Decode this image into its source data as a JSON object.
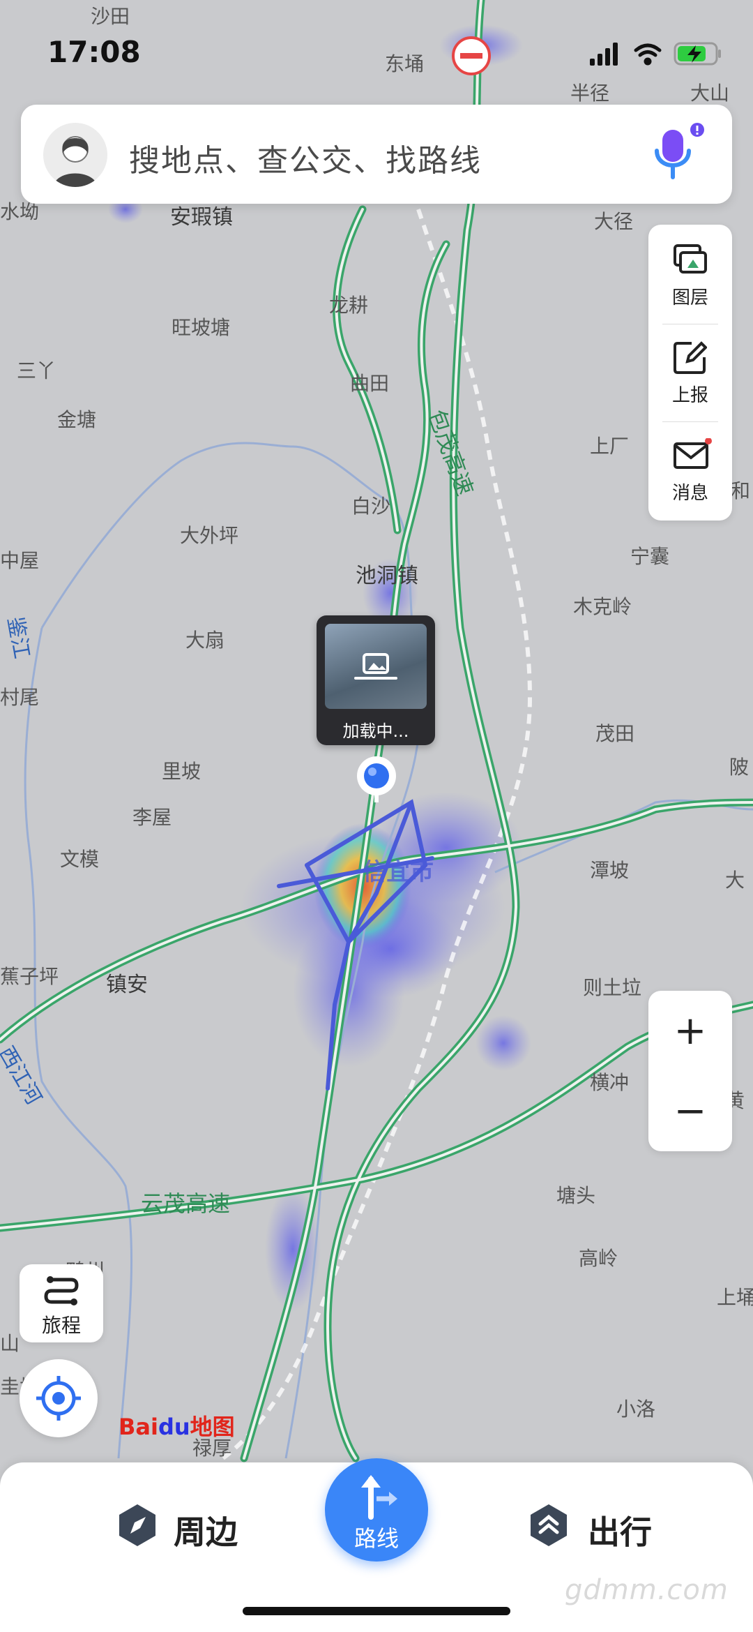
{
  "status_bar": {
    "time": "17:08"
  },
  "search": {
    "placeholder": "搜地点、查公交、找路线"
  },
  "side_tools": [
    {
      "label": "图层",
      "icon": "layers-icon"
    },
    {
      "label": "上报",
      "icon": "report-edit-icon"
    },
    {
      "label": "消息",
      "icon": "mail-icon"
    }
  ],
  "zoom": {
    "in_label": "+",
    "out_label": "−"
  },
  "trip": {
    "label": "旅程"
  },
  "loading_card": {
    "label": "加载中..."
  },
  "bottom_nav": {
    "nearby": "周边",
    "route": "路线",
    "go": "出行"
  },
  "brand": {
    "baidu_a": "Bai",
    "baidu_b": "du",
    "baidu_c": "地图"
  },
  "watermark": "gdmm.com",
  "map_labels": [
    {
      "text": "沙田",
      "kind": "place"
    },
    {
      "text": "东埇",
      "kind": "place"
    },
    {
      "text": "半径",
      "kind": "place"
    },
    {
      "text": "大山",
      "kind": "place"
    },
    {
      "text": "水坳",
      "kind": "place"
    },
    {
      "text": "安瑕镇",
      "kind": "town"
    },
    {
      "text": "大径",
      "kind": "place"
    },
    {
      "text": "龙耕",
      "kind": "place"
    },
    {
      "text": "旺坡塘",
      "kind": "place"
    },
    {
      "text": "三丫",
      "kind": "place"
    },
    {
      "text": "曲田",
      "kind": "place"
    },
    {
      "text": "金塘",
      "kind": "place"
    },
    {
      "text": "上厂",
      "kind": "place"
    },
    {
      "text": "和",
      "kind": "place"
    },
    {
      "text": "包茂高速",
      "kind": "road"
    },
    {
      "text": "白沙",
      "kind": "place"
    },
    {
      "text": "大外坪",
      "kind": "place"
    },
    {
      "text": "中屋",
      "kind": "place"
    },
    {
      "text": "宁囊",
      "kind": "place"
    },
    {
      "text": "池洞镇",
      "kind": "town"
    },
    {
      "text": "木克岭",
      "kind": "place"
    },
    {
      "text": "鉴江",
      "kind": "river"
    },
    {
      "text": "大扇",
      "kind": "place"
    },
    {
      "text": "村尾",
      "kind": "place"
    },
    {
      "text": "茂田",
      "kind": "place"
    },
    {
      "text": "里坡",
      "kind": "place"
    },
    {
      "text": "陂",
      "kind": "place"
    },
    {
      "text": "李屋",
      "kind": "place"
    },
    {
      "text": "文模",
      "kind": "place"
    },
    {
      "text": "信宜市",
      "kind": "town"
    },
    {
      "text": "潭坡",
      "kind": "place"
    },
    {
      "text": "大",
      "kind": "place"
    },
    {
      "text": "蕉子坪",
      "kind": "place"
    },
    {
      "text": "镇安",
      "kind": "town"
    },
    {
      "text": "则土垃",
      "kind": "place"
    },
    {
      "text": "西江河",
      "kind": "river"
    },
    {
      "text": "横冲",
      "kind": "place"
    },
    {
      "text": "黄",
      "kind": "place"
    },
    {
      "text": "云茂高速",
      "kind": "road"
    },
    {
      "text": "塘头",
      "kind": "place"
    },
    {
      "text": "高岭",
      "kind": "place"
    },
    {
      "text": "上埇",
      "kind": "place"
    },
    {
      "text": "鸭州",
      "kind": "place"
    },
    {
      "text": "山",
      "kind": "place"
    },
    {
      "text": "圭坑",
      "kind": "place"
    },
    {
      "text": "小洛",
      "kind": "place"
    },
    {
      "text": "禄厚",
      "kind": "place"
    }
  ]
}
